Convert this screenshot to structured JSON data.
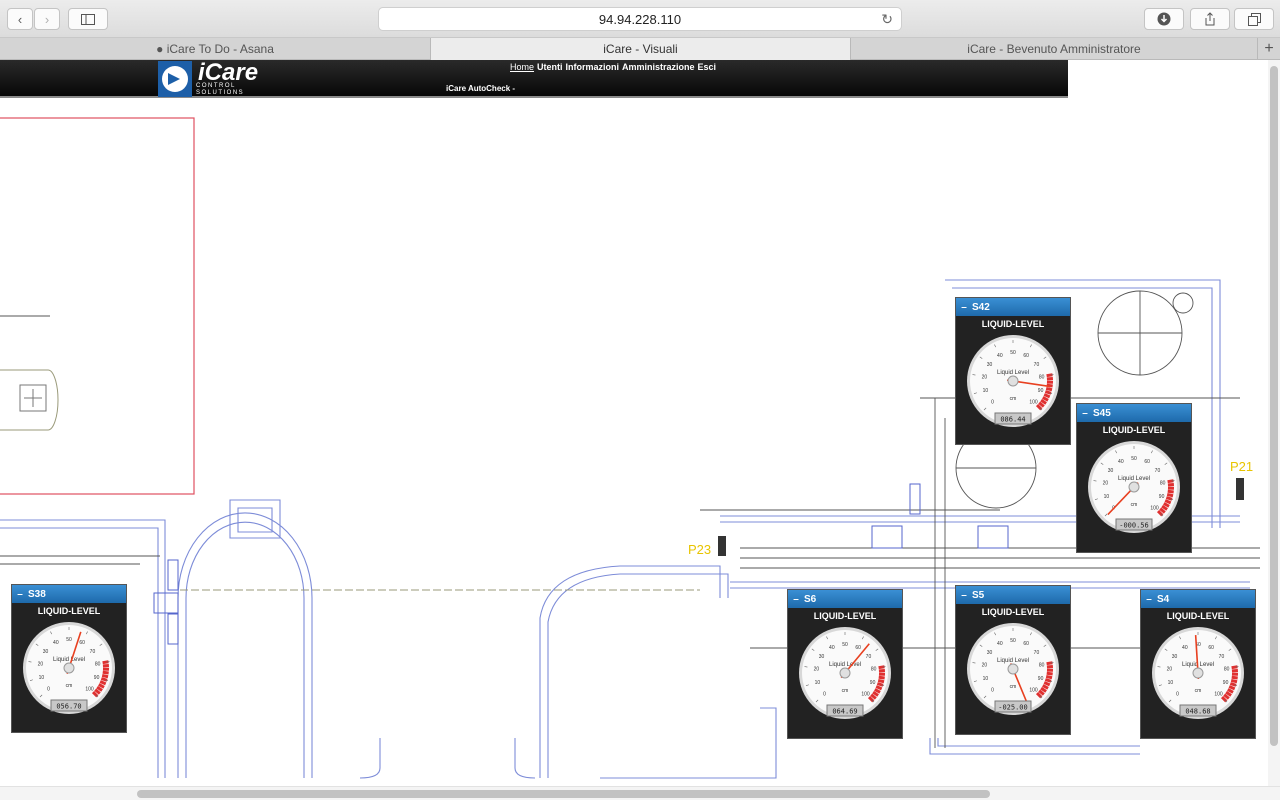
{
  "browser": {
    "url": "94.94.228.110",
    "tabs": [
      {
        "label": "● iCare To Do - Asana",
        "active": false
      },
      {
        "label": "iCare - Visuali",
        "active": true
      },
      {
        "label": "iCare - Bevenuto Amministratore",
        "active": false
      }
    ]
  },
  "header": {
    "logo_text": "iCare",
    "logo_sub1": "CONTROL",
    "logo_sub2": "SOLUTIONS",
    "nav": [
      "Home",
      "Utenti",
      "Informazioni",
      "Amministrazione",
      "Esci"
    ],
    "autocheck": "iCare AutoCheck -"
  },
  "labels": {
    "p23": "P23",
    "p21": "P21"
  },
  "gauge_scale": {
    "ticks": [
      "0",
      "10",
      "20",
      "30",
      "40",
      "50",
      "60",
      "70",
      "80",
      "90",
      "100"
    ],
    "center_label": "Liquid Level",
    "unit": "cm"
  },
  "widgets": [
    {
      "id": "S42",
      "type": "LIQUID-LEVEL",
      "display": "086.44",
      "value": 86.44
    },
    {
      "id": "S45",
      "type": "LIQUID-LEVEL",
      "display": "-000.56",
      "value": -0.56
    },
    {
      "id": "S38",
      "type": "LIQUID-LEVEL",
      "display": "056.70",
      "value": 56.7
    },
    {
      "id": "S6",
      "type": "LIQUID-LEVEL",
      "display": "064.69",
      "value": 64.69
    },
    {
      "id": "S5",
      "type": "LIQUID-LEVEL",
      "display": "-025.00",
      "value": -25.0
    },
    {
      "id": "S4",
      "type": "LIQUID-LEVEL",
      "display": "048.68",
      "value": 48.68
    }
  ]
}
